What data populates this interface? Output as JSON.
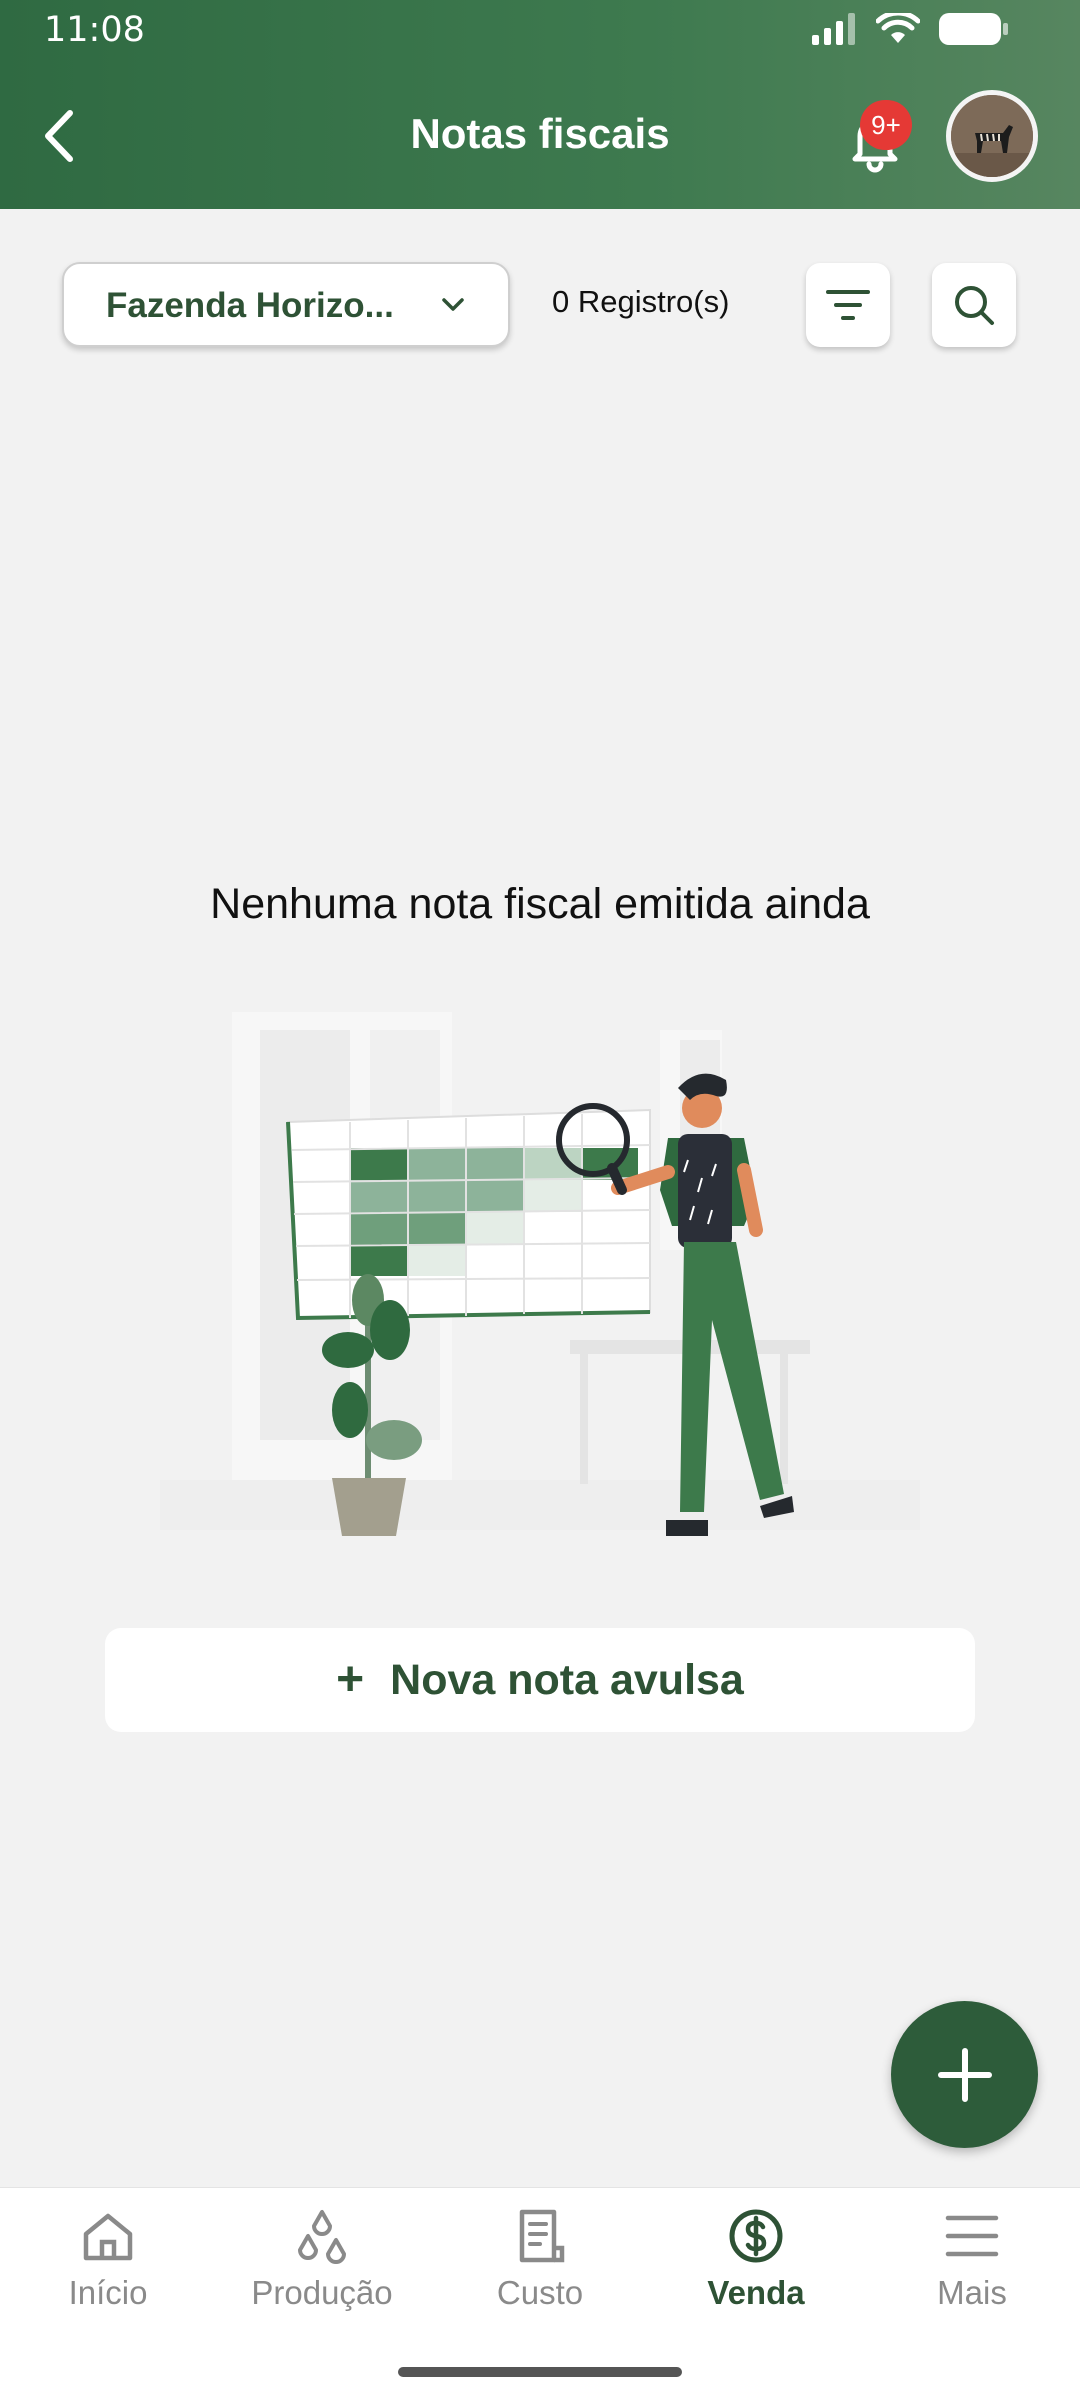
{
  "status_bar": {
    "time": "11:08"
  },
  "header": {
    "title": "Notas fiscais",
    "notification_badge": "9+"
  },
  "toolbar": {
    "farm_select": "Fazenda Horizo...",
    "record_count": "0 Registro(s)"
  },
  "empty_state": {
    "message": "Nenhuma nota fiscal emitida ainda",
    "button_label": "Nova nota avulsa",
    "button_icon": "+"
  },
  "bottom_nav": {
    "items": [
      {
        "label": "Início",
        "icon": "home-icon"
      },
      {
        "label": "Produção",
        "icon": "drops-icon"
      },
      {
        "label": "Custo",
        "icon": "receipt-icon"
      },
      {
        "label": "Venda",
        "icon": "dollar-circle-icon",
        "active": true
      },
      {
        "label": "Mais",
        "icon": "menu-icon"
      }
    ]
  },
  "colors": {
    "header_green": "#3e7a4f",
    "accent_green": "#2e5235",
    "fab_green": "#2d5c3a",
    "badge_red": "#e53935"
  }
}
